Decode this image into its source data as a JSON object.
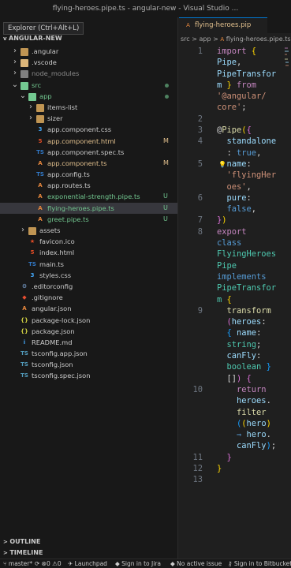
{
  "window": {
    "title": "flying-heroes.pipe.ts - angular-new - Visual Studio ..."
  },
  "sidebar": {
    "tooltip": "Explorer (Ctrl+Alt+L)",
    "root": "ANGULAR-NEW",
    "tree": [
      {
        "label": "angular",
        "kind": "folder",
        "depth": 1,
        "chev": ">",
        "prefix": "."
      },
      {
        "label": ".vscode",
        "kind": "folder-blue",
        "depth": 1,
        "chev": ">"
      },
      {
        "label": "node_modules",
        "kind": "folder-grey",
        "depth": 1,
        "chev": ">",
        "dim": true
      },
      {
        "label": "src",
        "kind": "folder-green",
        "depth": 1,
        "chev": "v",
        "dot": true
      },
      {
        "label": "app",
        "kind": "folder-green",
        "depth": 2,
        "chev": "v",
        "dot": true
      },
      {
        "label": "items-list",
        "kind": "folder",
        "depth": 3,
        "chev": ">"
      },
      {
        "label": "sizer",
        "kind": "folder",
        "depth": 3,
        "chev": ">"
      },
      {
        "label": "app.component.css",
        "kind": "css",
        "depth": 3
      },
      {
        "label": "app.component.html",
        "kind": "html",
        "depth": 3,
        "badge": "M",
        "mod": true
      },
      {
        "label": "app.component.spec.ts",
        "kind": "ts",
        "depth": 3
      },
      {
        "label": "app.component.ts",
        "kind": "ng",
        "depth": 3,
        "badge": "M",
        "mod": true
      },
      {
        "label": "app.config.ts",
        "kind": "ts",
        "depth": 3
      },
      {
        "label": "app.routes.ts",
        "kind": "ng",
        "depth": 3
      },
      {
        "label": "exponential-strength.pipe.ts",
        "kind": "ng",
        "depth": 3,
        "badge": "U",
        "new": true
      },
      {
        "label": "flying-heroes.pipe.ts",
        "kind": "ng",
        "depth": 3,
        "badge": "U",
        "new": true,
        "selected": true
      },
      {
        "label": "greet.pipe.ts",
        "kind": "ng",
        "depth": 3,
        "badge": "U",
        "new": true
      },
      {
        "label": "assets",
        "kind": "folder",
        "depth": 2,
        "chev": ">"
      },
      {
        "label": "favicon.ico",
        "kind": "star",
        "depth": 2
      },
      {
        "label": "index.html",
        "kind": "html",
        "depth": 2
      },
      {
        "label": "main.ts",
        "kind": "ts",
        "depth": 2
      },
      {
        "label": "styles.css",
        "kind": "css",
        "depth": 2
      },
      {
        "label": ".editorconfig",
        "kind": "gear",
        "depth": 1
      },
      {
        "label": ".gitignore",
        "kind": "git",
        "depth": 1
      },
      {
        "label": "angular.json",
        "kind": "ng",
        "depth": 1
      },
      {
        "label": "package-lock.json",
        "kind": "json",
        "depth": 1
      },
      {
        "label": "package.json",
        "kind": "json",
        "depth": 1
      },
      {
        "label": "README.md",
        "kind": "info",
        "depth": 1
      },
      {
        "label": "tsconfig.app.json",
        "kind": "tsconfig",
        "depth": 1
      },
      {
        "label": "tsconfig.json",
        "kind": "tsconfig",
        "depth": 1
      },
      {
        "label": "tsconfig.spec.json",
        "kind": "tsconfig",
        "depth": 1
      }
    ],
    "outline": "OUTLINE",
    "timeline": "TIMELINE"
  },
  "editor": {
    "tab": "flying-heroes.pip",
    "breadcrumb": [
      "src",
      "app",
      "flying-heroes.pipe.ts"
    ],
    "lines": [
      {
        "n": "1",
        "tokens": [
          [
            "import ",
            "k"
          ],
          [
            "{",
            "y"
          ]
        ]
      },
      {
        "n": "",
        "tokens": [
          [
            "Pipe",
            "v"
          ],
          [
            ",",
            "p"
          ]
        ]
      },
      {
        "n": "",
        "tokens": [
          [
            "PipeTransfor",
            "v"
          ]
        ]
      },
      {
        "n": "",
        "tokens": [
          [
            "m ",
            "v"
          ],
          [
            "}",
            "y"
          ],
          [
            " from",
            "k"
          ]
        ]
      },
      {
        "n": "",
        "tokens": [
          [
            "'@angular/",
            "s"
          ]
        ]
      },
      {
        "n": "",
        "tokens": [
          [
            "core'",
            "s"
          ],
          [
            ";",
            "p"
          ]
        ]
      },
      {
        "n": "2",
        "tokens": []
      },
      {
        "n": "3",
        "tokens": [
          [
            "@",
            "p"
          ],
          [
            "Pipe",
            "dec"
          ],
          [
            "(",
            "y"
          ],
          [
            "{",
            "m"
          ]
        ]
      },
      {
        "n": "4",
        "tokens": [
          [
            "  standalone",
            "v"
          ]
        ]
      },
      {
        "n": "",
        "tokens": [
          [
            "  : ",
            "p"
          ],
          [
            "true",
            "b"
          ],
          [
            ",",
            "p"
          ]
        ]
      },
      {
        "n": "5",
        "tokens": [
          [
            "  name",
            "v"
          ],
          [
            ":",
            "p"
          ]
        ],
        "bulb": true
      },
      {
        "n": "",
        "tokens": [
          [
            "  'flyingHer",
            "s"
          ]
        ]
      },
      {
        "n": "",
        "tokens": [
          [
            "  oes'",
            "s"
          ],
          [
            ",",
            "p"
          ]
        ]
      },
      {
        "n": "6",
        "tokens": [
          [
            "  pure",
            "v"
          ],
          [
            ":",
            "p"
          ]
        ]
      },
      {
        "n": "",
        "tokens": [
          [
            "  false",
            "b"
          ],
          [
            ",",
            "p"
          ]
        ]
      },
      {
        "n": "7",
        "tokens": [
          [
            "}",
            "m"
          ],
          [
            ")",
            "y"
          ]
        ]
      },
      {
        "n": "8",
        "tokens": [
          [
            "export",
            "k"
          ]
        ]
      },
      {
        "n": "",
        "tokens": [
          [
            "class",
            "b"
          ]
        ]
      },
      {
        "n": "",
        "tokens": [
          [
            "FlyingHeroes",
            "t"
          ]
        ]
      },
      {
        "n": "",
        "tokens": [
          [
            "Pipe",
            "t"
          ]
        ]
      },
      {
        "n": "",
        "tokens": [
          [
            "implements",
            "b"
          ]
        ]
      },
      {
        "n": "",
        "tokens": [
          [
            "PipeTransfor",
            "t"
          ]
        ]
      },
      {
        "n": "",
        "tokens": [
          [
            "m ",
            "t"
          ],
          [
            "{",
            "y"
          ]
        ]
      },
      {
        "n": "9",
        "tokens": [
          [
            "  transform",
            "f"
          ]
        ]
      },
      {
        "n": "",
        "tokens": [
          [
            "  (",
            "m"
          ],
          [
            "heroes",
            "v"
          ],
          [
            ":",
            "p"
          ]
        ]
      },
      {
        "n": "",
        "tokens": [
          [
            "  { ",
            "w"
          ],
          [
            "name",
            "v"
          ],
          [
            ":",
            "p"
          ]
        ]
      },
      {
        "n": "",
        "tokens": [
          [
            "  string",
            "t"
          ],
          [
            ";",
            "p"
          ]
        ]
      },
      {
        "n": "",
        "tokens": [
          [
            "  canFly",
            "v"
          ],
          [
            ":",
            "p"
          ]
        ]
      },
      {
        "n": "",
        "tokens": [
          [
            "  boolean ",
            "t"
          ],
          [
            "}",
            "w"
          ]
        ]
      },
      {
        "n": "",
        "tokens": [
          [
            "  []",
            "p"
          ],
          [
            ") ",
            "m"
          ],
          [
            "{",
            "m"
          ]
        ]
      },
      {
        "n": "10",
        "tokens": [
          [
            "    return",
            "k"
          ]
        ]
      },
      {
        "n": "",
        "tokens": [
          [
            "    heroes",
            "v"
          ],
          [
            ".",
            "p"
          ]
        ]
      },
      {
        "n": "",
        "tokens": [
          [
            "    filter",
            "f"
          ]
        ]
      },
      {
        "n": "",
        "tokens": [
          [
            "    (",
            "w"
          ],
          [
            "(",
            "y"
          ],
          [
            "hero",
            "v"
          ],
          [
            ")",
            "y"
          ]
        ]
      },
      {
        "n": "",
        "tokens": [
          [
            "    ⇒ ",
            "b"
          ],
          [
            "hero",
            "v"
          ],
          [
            ".",
            "p"
          ]
        ]
      },
      {
        "n": "",
        "tokens": [
          [
            "    canFly",
            "v"
          ],
          [
            ")",
            "w"
          ],
          [
            ";",
            "p"
          ]
        ]
      },
      {
        "n": "11",
        "tokens": [
          [
            "  }",
            "m"
          ]
        ]
      },
      {
        "n": "12",
        "tokens": [
          [
            "}",
            "y"
          ]
        ]
      },
      {
        "n": "13",
        "tokens": []
      }
    ]
  },
  "statusbar": {
    "branch": "master*",
    "launchpad": "Launchpad",
    "jira": "Sign in to Jira",
    "issue": "No active issue",
    "bitbucket": "Sign in to Bitbucket"
  },
  "colors": {
    "modified": "#e2c08d",
    "untracked": "#73c991",
    "selection": "#37373d",
    "accent": "#0078d4"
  }
}
